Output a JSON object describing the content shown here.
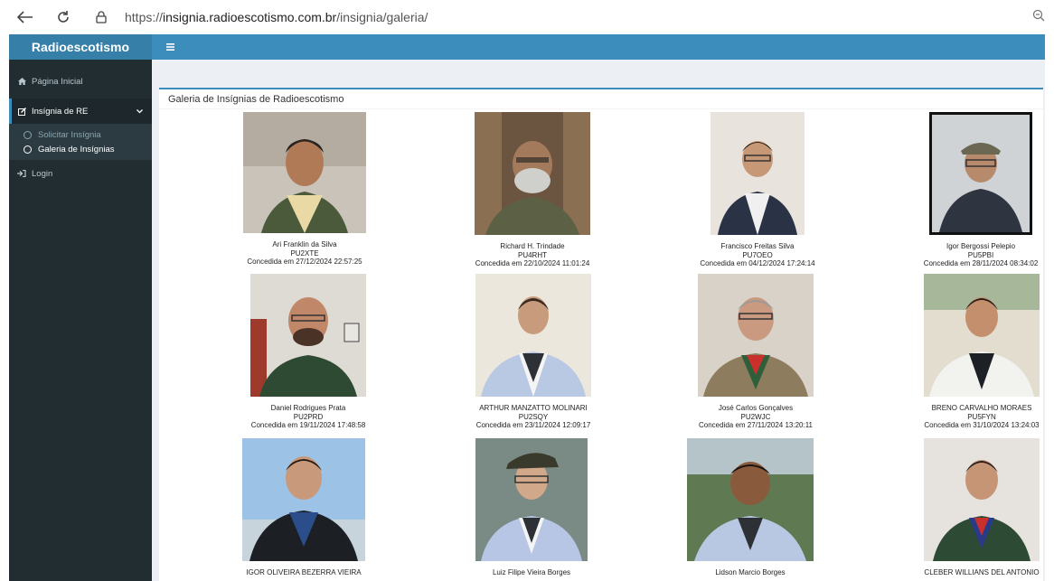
{
  "browser": {
    "url_prefix": "https://",
    "url_host": "insignia.radioescotismo.com.br",
    "url_path": "/insignia/galeria/"
  },
  "app": {
    "brand": "Radioescotismo",
    "accent_color": "#3c8dbc",
    "sidebar_color": "#222d32"
  },
  "sidebar": {
    "home": "Página Inicial",
    "insignia": "Insígnia de RE",
    "request": "Solicitar Insígnia",
    "gallery": "Galeria de Insígnias",
    "login": "Login"
  },
  "gallery": {
    "title": "Galeria de Insígnias de Radioescotismo",
    "items": [
      {
        "name": "Ari Franklin da Silva",
        "call": "PU2XTE",
        "date": "Concedida em 27/12/2024 22:57:25"
      },
      {
        "name": "Richard H. Trindade",
        "call": "PU4RHT",
        "date": "Concedida em 22/10/2024 11:01:24"
      },
      {
        "name": "Francisco Freitas Silva",
        "call": "PU7OEO",
        "date": "Concedida em 04/12/2024 17:24:14"
      },
      {
        "name": "Igor Bergossi Pelepio",
        "call": "PU5PBI",
        "date": "Concedida em 28/11/2024 08:34:02"
      },
      {
        "name": "Daniel Rodrigues Prata",
        "call": "PU2PRD",
        "date": "Concedida em 19/11/2024 17:48:58"
      },
      {
        "name": "ARTHUR MANZATTO MOLINARI",
        "call": "PU2SQY",
        "date": "Concedida em 23/11/2024 12:09:17"
      },
      {
        "name": "José Carlos Gonçalves",
        "call": "PU2WJC",
        "date": "Concedida em 27/11/2024 13:20:11"
      },
      {
        "name": "BRENO CARVALHO MORAES",
        "call": "PU5FYN",
        "date": "Concedida em 31/10/2024 13:24:03"
      },
      {
        "name": "IGOR OLIVEIRA BEZERRA VIEIRA",
        "call": "",
        "date": ""
      },
      {
        "name": "Luiz Filipe Vieira Borges",
        "call": "",
        "date": ""
      },
      {
        "name": "Lidson Marcio Borges",
        "call": "",
        "date": ""
      },
      {
        "name": "CLEBER WILLIANS DEL ANTONIO",
        "call": "",
        "date": ""
      }
    ]
  }
}
